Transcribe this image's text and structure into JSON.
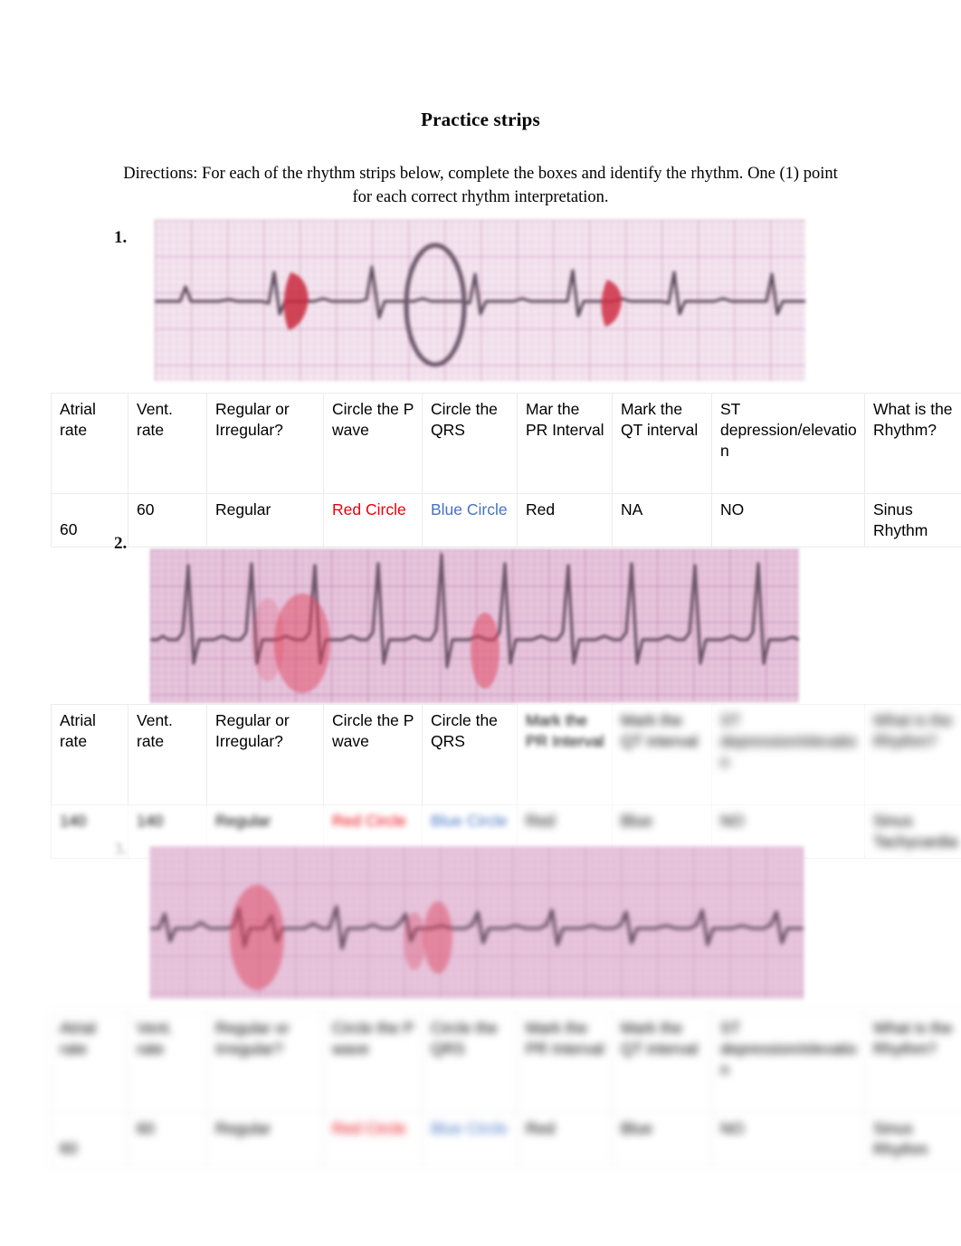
{
  "document": {
    "title": "Practice strips",
    "directions_line1": "Directions: For each of the rhythm strips below, complete the boxes and identify the rhythm.",
    "directions_line2": "One (1) point for each correct rhythm interpretation."
  },
  "list_markers": {
    "item1": "1.",
    "item2": "2.",
    "item3": "3."
  },
  "colors": {
    "red_text": "#e8000d",
    "blue_text": "#4472c4",
    "strip1_paper": "#f5e7f1",
    "strip2_paper": "#e7c6dd",
    "strip3_paper": "#e9c8de",
    "table_border": "#ececec"
  },
  "table_headers": [
    "Atrial rate",
    "Vent. rate",
    "Regular or Irregular?",
    "Circle the P wave",
    "Circle the QRS",
    "Mar the PR Interval",
    "Mark the QT interval",
    "ST depression/elevation",
    "What is the Rhythm?"
  ],
  "tables": [
    {
      "id": "strip-1-table",
      "headers": [
        "Atrial rate",
        "Vent. rate",
        "Regular or Irregular?",
        "Circle the P wave",
        "Circle the QRS",
        "Mar the PR Interval",
        "Mark the QT interval",
        "ST depression/elevation",
        "What is the Rhythm?"
      ],
      "row": [
        "60",
        "60",
        "Regular",
        "Red Circle",
        "Blue Circle",
        "Red",
        "NA",
        "NO",
        "Sinus Rhythm"
      ]
    },
    {
      "id": "strip-2-table",
      "headers": [
        "Atrial rate",
        "Vent. rate",
        "Regular or Irregular?",
        "Circle the P wave",
        "Circle the QRS",
        "Mark the PR Interval",
        "Mark the QT interval",
        "ST depression/elevation",
        "What is the Rhythm?"
      ],
      "row": [
        "140",
        "140",
        "Regular",
        "Red Circle",
        "Blue Circle",
        "Red",
        "Blue",
        "NO",
        "Sinus Tachycardia"
      ]
    },
    {
      "id": "strip-3-table",
      "headers": [
        "Atrial rate",
        "Vent. rate",
        "Regular or Irregular?",
        "Circle the P wave",
        "Circle the QRS",
        "Mark the PR Interval",
        "Mark the QT interval",
        "ST depression/elevation",
        "What is the Rhythm?"
      ],
      "row": [
        "60",
        "60",
        "Regular",
        "Red Circle",
        "Blue Circle",
        "Red",
        "Blue",
        "NO",
        "Sinus Rhythm"
      ]
    }
  ],
  "strips": [
    {
      "id": "ecg-strip-1",
      "paper": "pink-graph-paper",
      "annotations": [
        "red-mark",
        "dark-ellipse-circle",
        "red-mark"
      ]
    },
    {
      "id": "ecg-strip-2",
      "paper": "pink-graph-paper",
      "annotations": [
        "red-circle",
        "red-circle"
      ]
    },
    {
      "id": "ecg-strip-3",
      "paper": "pink-graph-paper",
      "annotations": [
        "red-ellipse-circle",
        "red-circle"
      ]
    }
  ]
}
